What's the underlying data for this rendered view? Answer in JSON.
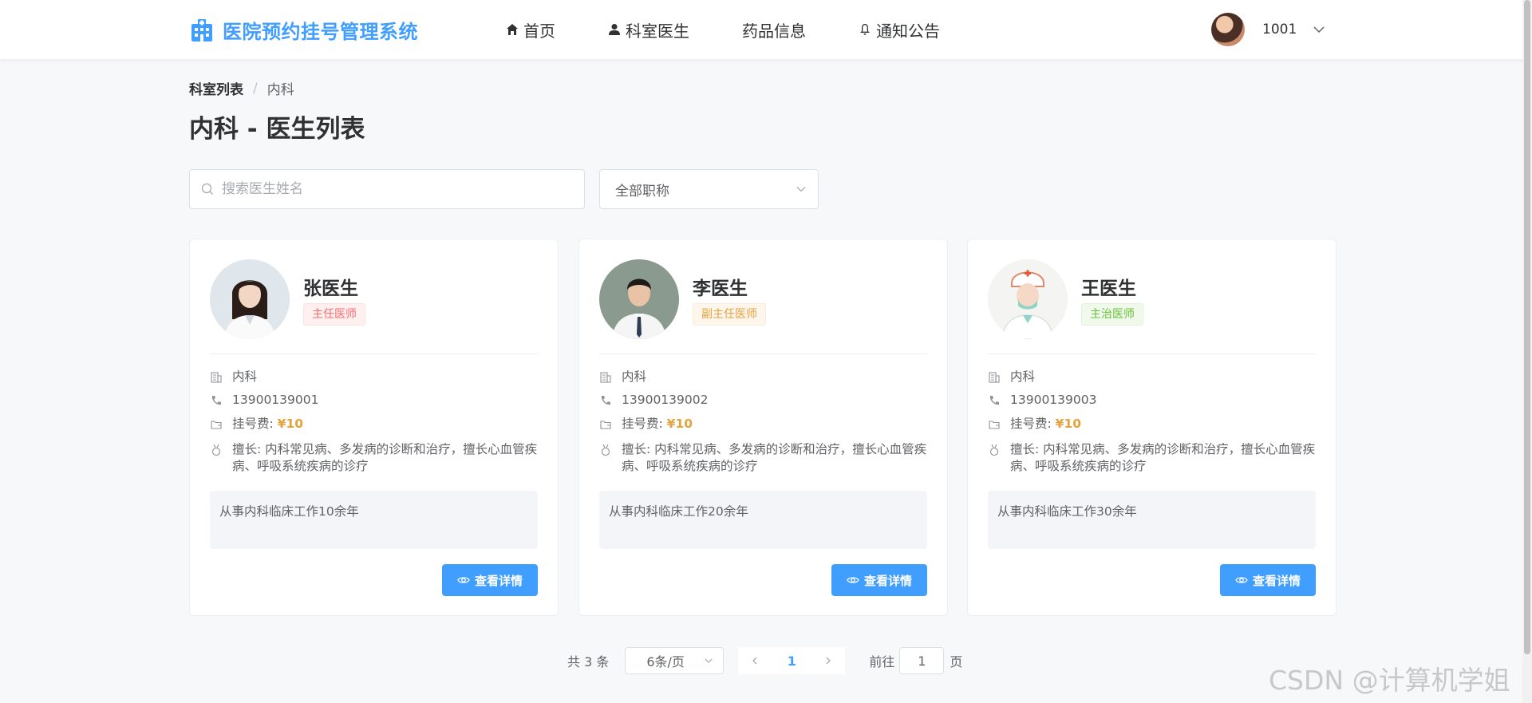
{
  "header": {
    "logo_text": "医院预约挂号管理系统",
    "nav": [
      {
        "label": "首页",
        "icon": "home-icon"
      },
      {
        "label": "科室医生",
        "icon": "user-icon"
      },
      {
        "label": "药品信息",
        "icon": ""
      },
      {
        "label": "通知公告",
        "icon": "bell-icon"
      }
    ],
    "user_name": "1001"
  },
  "breadcrumb": {
    "parent": "科室列表",
    "separator": "/",
    "current": "内科"
  },
  "page_title": "内科 - 医生列表",
  "filters": {
    "search_placeholder": "搜索医生姓名",
    "title_select": "全部职称"
  },
  "doctors": [
    {
      "name": "张医生",
      "title": "主任医师",
      "title_color": "#f56c6c",
      "department": "内科",
      "phone": "13900139001",
      "fee_label": "挂号费:",
      "fee": "¥10",
      "specialty": "擅长: 内科常见病、多发病的诊断和治疗，擅长心血管疾病、呼吸系统疾病的诊疗",
      "description": "从事内科临床工作10余年",
      "button": "查看详情"
    },
    {
      "name": "李医生",
      "title": "副主任医师",
      "title_color": "#e6a23c",
      "department": "内科",
      "phone": "13900139002",
      "fee_label": "挂号费:",
      "fee": "¥10",
      "specialty": "擅长: 内科常见病、多发病的诊断和治疗，擅长心血管疾病、呼吸系统疾病的诊疗",
      "description": "从事内科临床工作20余年",
      "button": "查看详情"
    },
    {
      "name": "王医生",
      "title": "主治医师",
      "title_color": "#67c23a",
      "department": "内科",
      "phone": "13900139003",
      "fee_label": "挂号费:",
      "fee": "¥10",
      "specialty": "擅长: 内科常见病、多发病的诊断和治疗，擅长心血管疾病、呼吸系统疾病的诊疗",
      "description": "从事内科临床工作30余年",
      "button": "查看详情"
    }
  ],
  "pagination": {
    "total": "共 3 条",
    "page_size": "6条/页",
    "current_page": "1",
    "goto_prefix": "前往",
    "goto_value": "1",
    "goto_suffix": "页"
  },
  "watermark": "CSDN @计算机学姐",
  "colors": {
    "primary": "#409eff",
    "fee": "#e6a23c"
  }
}
